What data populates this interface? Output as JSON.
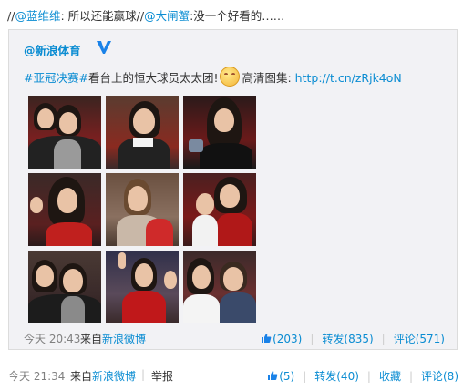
{
  "repost": {
    "prefix1": "//",
    "user1": "@蓝维维",
    "text1": ": 所以还能赢球//",
    "user2": "@大闸蟹",
    "text2": ":没一个好看的……"
  },
  "original": {
    "author": "@新浪体育",
    "verified_label": "V",
    "hashtag": "#亚冠决赛#",
    "text": "看台上的恒大球员太太团!",
    "text2": "高清图集:",
    "url": "http://t.cn/zRjk4oN",
    "emoji": "smile-emoji",
    "photo_count": 9,
    "time": "今天 20:43",
    "source_prefix": "来自",
    "source": "新浪微博",
    "likes": "(203)",
    "repost_label": "转发(835)",
    "comment_label": "评论(571)"
  },
  "footer": {
    "time": "今天 21:34",
    "source_prefix": "来自",
    "source": "新浪微博",
    "report": "举报",
    "likes": "(5)",
    "repost_label": "转发(40)",
    "favorite_label": "收藏",
    "comment_label": "评论(8)"
  },
  "colors": {
    "link": "#0a8cd2",
    "muted": "#808080",
    "panel": "#f2f2f5",
    "verified": "#1a82e8"
  }
}
